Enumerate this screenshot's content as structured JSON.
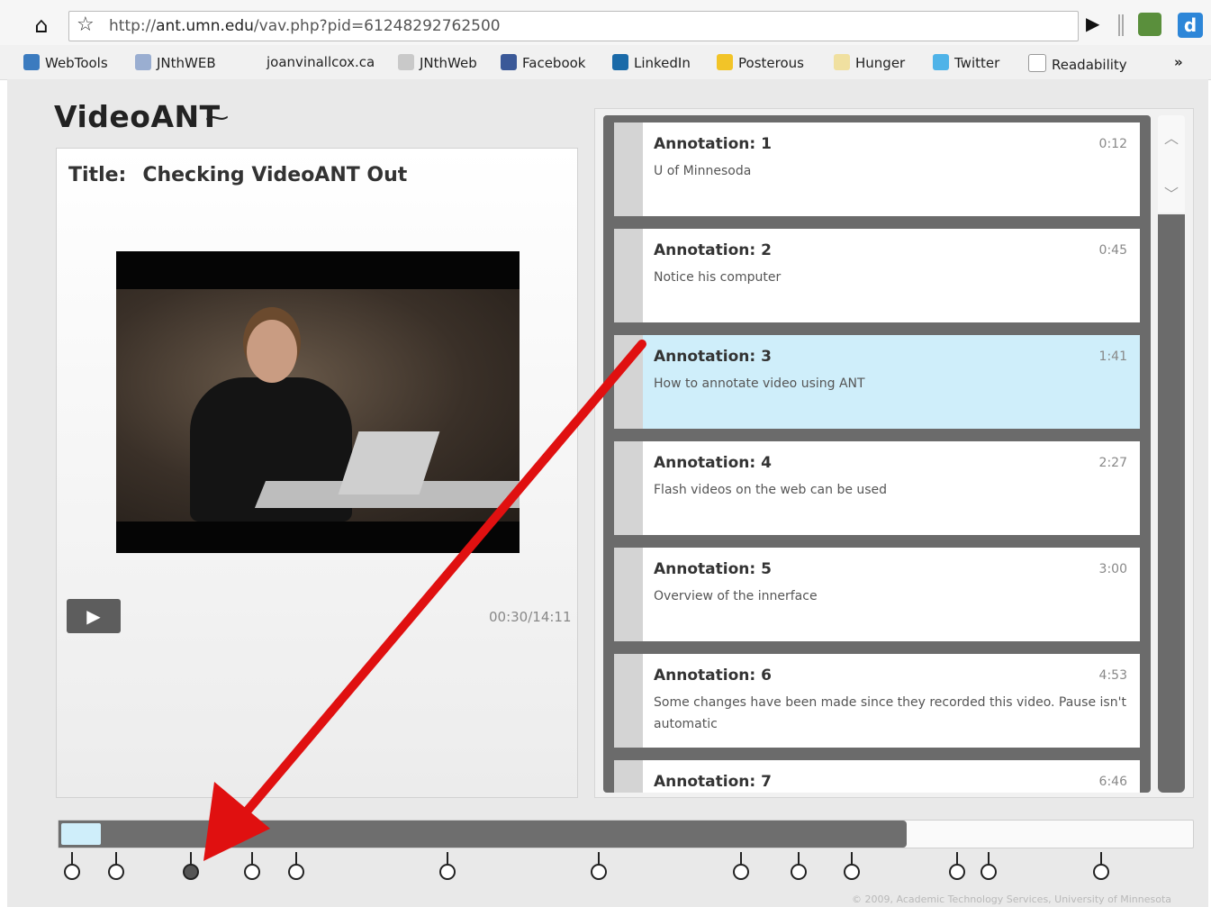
{
  "browser": {
    "url_prefix": "http://",
    "url_host": "ant.umn.edu",
    "url_path": "/vav.php?pid=61248292762500",
    "ext_label": "d"
  },
  "bookmarks": [
    {
      "label": "WebTools",
      "icon": "wordpress-icon",
      "color": "#3b7bbf"
    },
    {
      "label": "JNthWEB",
      "icon": "jnthweb-icon",
      "color": "#9aaed1"
    },
    {
      "label": "joanvinallcox.ca",
      "icon": "",
      "color": ""
    },
    {
      "label": "JNthWeb",
      "icon": "posterous-pb-icon",
      "color": "#c9c9c9"
    },
    {
      "label": "Facebook",
      "icon": "facebook-icon",
      "color": "#3b5998"
    },
    {
      "label": "LinkedIn",
      "icon": "linkedin-icon",
      "color": "#1a6aa8"
    },
    {
      "label": "Posterous",
      "icon": "posterous-icon",
      "color": "#f2c428"
    },
    {
      "label": "Hunger",
      "icon": "hunger-icon",
      "color": "#f0e0a0"
    },
    {
      "label": "Twitter",
      "icon": "twitter-icon",
      "color": "#4fb3e8"
    },
    {
      "label": "Readability",
      "icon": "page-icon",
      "color": "#ffffff"
    }
  ],
  "app": {
    "logo": "VideoANT",
    "title_label": "Title:",
    "title_value": "Checking VideoANT Out",
    "timecode": "00:30/14:11",
    "timeline_progress": 0.748,
    "footer": "© 2009, Academic Technology Services, University of Minnesota"
  },
  "annotations": [
    {
      "heading": "Annotation: 1",
      "time": "0:12",
      "text": "U of Minnesoda"
    },
    {
      "heading": "Annotation: 2",
      "time": "0:45",
      "text": "Notice his computer"
    },
    {
      "heading": "Annotation: 3",
      "time": "1:41",
      "text": "How to annotate video using ANT",
      "active": true
    },
    {
      "heading": "Annotation: 4",
      "time": "2:27",
      "text": "Flash videos on the web can be used"
    },
    {
      "heading": "Annotation: 5",
      "time": "3:00",
      "text": "Overview of the innerface"
    },
    {
      "heading": "Annotation: 6",
      "time": "4:53",
      "text": "Some changes have been made since they recorded this video. Pause isn't automatic"
    },
    {
      "heading": "Annotation: 7",
      "time": "6:46",
      "text": ""
    }
  ],
  "colors": {
    "active_card": "#cfeefa",
    "arrow": "#e01010"
  }
}
